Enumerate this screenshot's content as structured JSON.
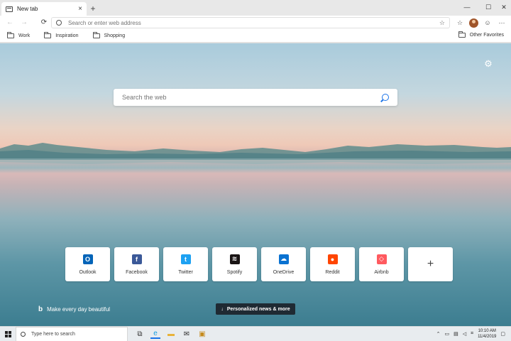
{
  "tab": {
    "title": "New tab",
    "close_glyph": "×",
    "new_tab_glyph": "+"
  },
  "window": {
    "minimize_glyph": "—",
    "maximize_glyph": "☐",
    "close_glyph": "✕"
  },
  "nav": {
    "back_glyph": "←",
    "forward_glyph": "→",
    "refresh_glyph": "⟳",
    "address_placeholder": "Search or enter web address",
    "favorite_glyph": "☆",
    "collections_glyph": "☆",
    "emoji_glyph": "☺",
    "more_glyph": "···"
  },
  "favorites": {
    "items": [
      {
        "label": "Work"
      },
      {
        "label": "Inspiration"
      },
      {
        "label": "Shopping"
      }
    ],
    "other": "Other Favorites"
  },
  "page": {
    "settings_glyph": "⚙",
    "search_placeholder": "Search the web",
    "quick_links": [
      {
        "label": "Outlook",
        "icon": "outlook-icon",
        "color": "#0364b8",
        "glyph": "O"
      },
      {
        "label": "Facebook",
        "icon": "facebook-icon",
        "color": "#3b5998",
        "glyph": "f"
      },
      {
        "label": "Twitter",
        "icon": "twitter-icon",
        "color": "#1da1f2",
        "glyph": "t"
      },
      {
        "label": "Spotify",
        "icon": "spotify-icon",
        "color": "#191414",
        "glyph": "≋"
      },
      {
        "label": "OneDrive",
        "icon": "onedrive-icon",
        "color": "#0a72d1",
        "glyph": "☁"
      },
      {
        "label": "Reddit",
        "icon": "reddit-icon",
        "color": "#ff4500",
        "glyph": "●"
      },
      {
        "label": "Airbnb",
        "icon": "airbnb-icon",
        "color": "#ff5a5f",
        "glyph": "◇"
      }
    ],
    "add_glyph": "+",
    "bing_logo": "b",
    "bing_text": "Make every day beautiful",
    "news_arrow": "↓",
    "news_label": "Personalized news & more"
  },
  "taskbar": {
    "search_placeholder": "Type here to search",
    "apps": [
      {
        "icon": "task-view-icon",
        "glyph": "⧉",
        "color": "#333",
        "active": false
      },
      {
        "icon": "edge-icon",
        "glyph": "e",
        "color": "#1a9ee0",
        "active": true
      },
      {
        "icon": "file-explorer-icon",
        "glyph": "▬",
        "color": "#e8b33a",
        "active": false
      },
      {
        "icon": "mail-icon",
        "glyph": "✉",
        "color": "#333",
        "active": false
      },
      {
        "icon": "store-icon",
        "glyph": "▣",
        "color": "#c58b1e",
        "active": false
      }
    ],
    "time": "10:10 AM",
    "date": "11/4/2019"
  }
}
